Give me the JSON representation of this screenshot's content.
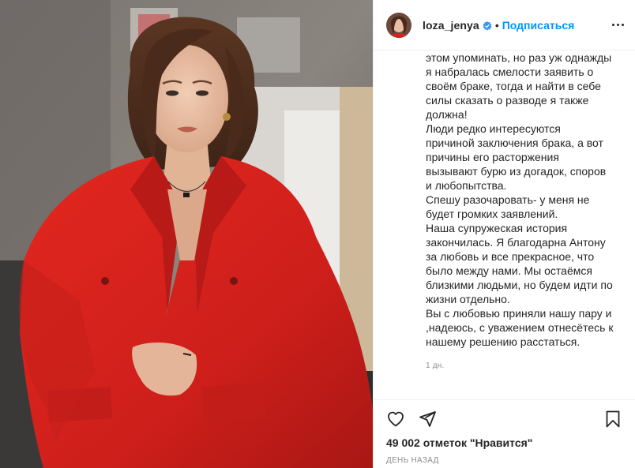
{
  "post": {
    "username": "loza_jenya",
    "follow_label": "Подписаться",
    "separator": "•",
    "caption_lines": [
      "этом упоминать, но раз уж однажды",
      "я набралась смелости заявить о",
      "своём браке, тогда и найти в себе",
      "силы сказать о разводе я также",
      "должна!",
      "Люди редко интересуются",
      "причиной заключения брака, а вот",
      "причины его расторжения",
      "вызывают бурю из догадок, споров",
      "и любопытства.",
      "Спешу разочаровать- у меня не",
      "будет громких заявлений.",
      "Наша супружеская история",
      "закончилась. Я благодарна Антону",
      "за любовь и все прекрасное, что",
      "было между нами. Мы остаёмся",
      "близкими людьми, но будем идти по",
      "жизни отдельно.",
      "Вы с любовью приняли нашу пару и",
      ",надеюсь, с уважением отнесётесь к",
      "нашему решению расстаться."
    ],
    "caption_time": "1 дн.",
    "likes_text": "49 002 отметок \"Нравится\"",
    "posted_ago": "день назад"
  },
  "colors": {
    "accent": "#0095f6",
    "text": "#262626",
    "muted": "#8e8e8e",
    "suit_red": "#d8221e"
  },
  "icons": {
    "verified": "verified-badge-icon",
    "more": "more-options-icon",
    "like": "heart-icon",
    "share": "paper-plane-icon",
    "save": "bookmark-icon"
  }
}
